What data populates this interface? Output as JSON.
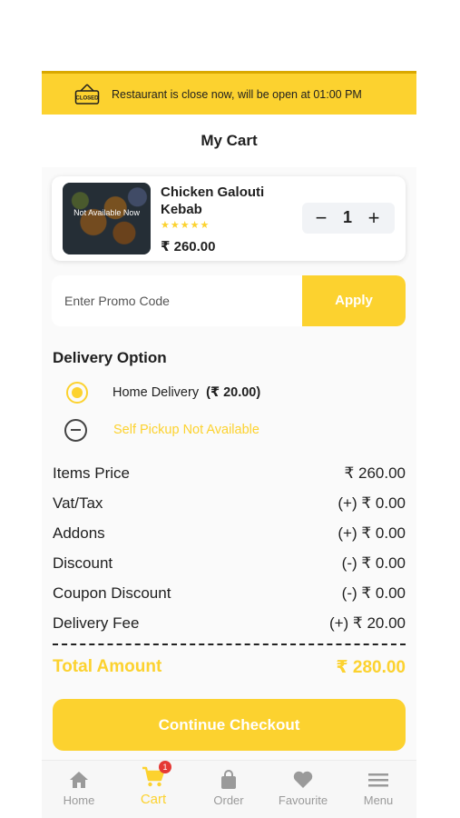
{
  "banner": {
    "text": "Restaurant is close now, will be open at 01:00 PM",
    "icon": "closed-sign-icon",
    "icon_text": "CLOSED"
  },
  "header": {
    "title": "My Cart"
  },
  "cart_item": {
    "name": "Chicken Galouti Kebab",
    "status_overlay": "Not Available Now",
    "rating_stars": 5,
    "stars": "★★★★★",
    "price": "₹ 260.00",
    "quantity": "1",
    "minus_label": "−",
    "plus_label": "+"
  },
  "promo": {
    "placeholder": "Enter Promo Code",
    "value": "",
    "apply_label": "Apply"
  },
  "delivery": {
    "title": "Delivery Option",
    "home_label": "Home Delivery",
    "home_fee": "(₹ 20.00)",
    "pickup_label": "Self Pickup Not Available"
  },
  "summary": [
    {
      "label": "Items Price",
      "value": "₹ 260.00"
    },
    {
      "label": "Vat/Tax",
      "value": "(+) ₹ 0.00"
    },
    {
      "label": "Addons",
      "value": "(+) ₹ 0.00"
    },
    {
      "label": "Discount",
      "value": "(-) ₹ 0.00"
    },
    {
      "label": "Coupon Discount",
      "value": "(-) ₹ 0.00"
    },
    {
      "label": "Delivery Fee",
      "value": "(+) ₹ 20.00"
    }
  ],
  "total": {
    "label": "Total Amount",
    "value": "₹ 280.00"
  },
  "checkout": {
    "label": "Continue Checkout"
  },
  "nav": {
    "items": [
      {
        "label": "Home",
        "icon": "home-icon"
      },
      {
        "label": "Cart",
        "icon": "cart-icon",
        "badge": "1"
      },
      {
        "label": "Order",
        "icon": "bag-icon"
      },
      {
        "label": "Favourite",
        "icon": "heart-icon"
      },
      {
        "label": "Menu",
        "icon": "menu-icon"
      }
    ]
  },
  "colors": {
    "accent": "#fcd22f",
    "badge": "#e53935",
    "inactive": "#9a9a9a"
  }
}
